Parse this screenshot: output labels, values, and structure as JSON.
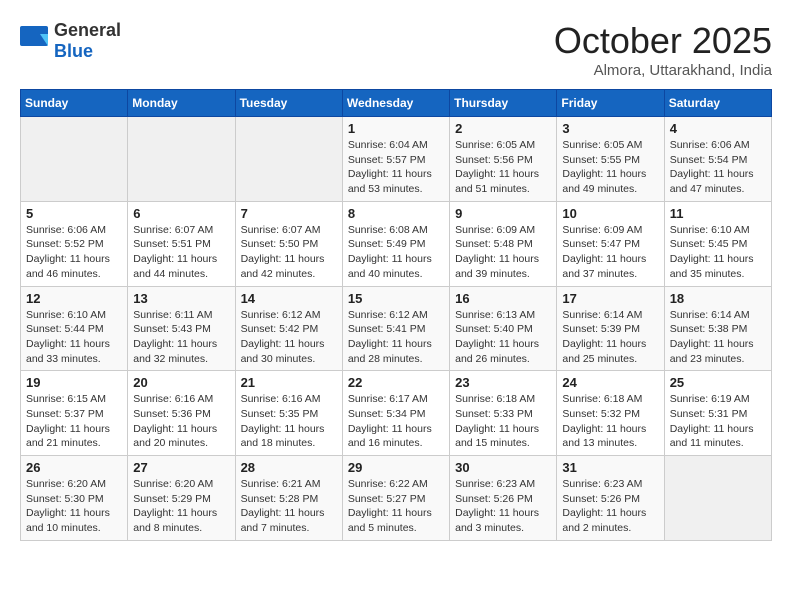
{
  "header": {
    "logo_general": "General",
    "logo_blue": "Blue",
    "month_title": "October 2025",
    "subtitle": "Almora, Uttarakhand, India"
  },
  "days_of_week": [
    "Sunday",
    "Monday",
    "Tuesday",
    "Wednesday",
    "Thursday",
    "Friday",
    "Saturday"
  ],
  "weeks": [
    [
      {
        "day": "",
        "info": ""
      },
      {
        "day": "",
        "info": ""
      },
      {
        "day": "",
        "info": ""
      },
      {
        "day": "1",
        "info": "Sunrise: 6:04 AM\nSunset: 5:57 PM\nDaylight: 11 hours and 53 minutes."
      },
      {
        "day": "2",
        "info": "Sunrise: 6:05 AM\nSunset: 5:56 PM\nDaylight: 11 hours and 51 minutes."
      },
      {
        "day": "3",
        "info": "Sunrise: 6:05 AM\nSunset: 5:55 PM\nDaylight: 11 hours and 49 minutes."
      },
      {
        "day": "4",
        "info": "Sunrise: 6:06 AM\nSunset: 5:54 PM\nDaylight: 11 hours and 47 minutes."
      }
    ],
    [
      {
        "day": "5",
        "info": "Sunrise: 6:06 AM\nSunset: 5:52 PM\nDaylight: 11 hours and 46 minutes."
      },
      {
        "day": "6",
        "info": "Sunrise: 6:07 AM\nSunset: 5:51 PM\nDaylight: 11 hours and 44 minutes."
      },
      {
        "day": "7",
        "info": "Sunrise: 6:07 AM\nSunset: 5:50 PM\nDaylight: 11 hours and 42 minutes."
      },
      {
        "day": "8",
        "info": "Sunrise: 6:08 AM\nSunset: 5:49 PM\nDaylight: 11 hours and 40 minutes."
      },
      {
        "day": "9",
        "info": "Sunrise: 6:09 AM\nSunset: 5:48 PM\nDaylight: 11 hours and 39 minutes."
      },
      {
        "day": "10",
        "info": "Sunrise: 6:09 AM\nSunset: 5:47 PM\nDaylight: 11 hours and 37 minutes."
      },
      {
        "day": "11",
        "info": "Sunrise: 6:10 AM\nSunset: 5:45 PM\nDaylight: 11 hours and 35 minutes."
      }
    ],
    [
      {
        "day": "12",
        "info": "Sunrise: 6:10 AM\nSunset: 5:44 PM\nDaylight: 11 hours and 33 minutes."
      },
      {
        "day": "13",
        "info": "Sunrise: 6:11 AM\nSunset: 5:43 PM\nDaylight: 11 hours and 32 minutes."
      },
      {
        "day": "14",
        "info": "Sunrise: 6:12 AM\nSunset: 5:42 PM\nDaylight: 11 hours and 30 minutes."
      },
      {
        "day": "15",
        "info": "Sunrise: 6:12 AM\nSunset: 5:41 PM\nDaylight: 11 hours and 28 minutes."
      },
      {
        "day": "16",
        "info": "Sunrise: 6:13 AM\nSunset: 5:40 PM\nDaylight: 11 hours and 26 minutes."
      },
      {
        "day": "17",
        "info": "Sunrise: 6:14 AM\nSunset: 5:39 PM\nDaylight: 11 hours and 25 minutes."
      },
      {
        "day": "18",
        "info": "Sunrise: 6:14 AM\nSunset: 5:38 PM\nDaylight: 11 hours and 23 minutes."
      }
    ],
    [
      {
        "day": "19",
        "info": "Sunrise: 6:15 AM\nSunset: 5:37 PM\nDaylight: 11 hours and 21 minutes."
      },
      {
        "day": "20",
        "info": "Sunrise: 6:16 AM\nSunset: 5:36 PM\nDaylight: 11 hours and 20 minutes."
      },
      {
        "day": "21",
        "info": "Sunrise: 6:16 AM\nSunset: 5:35 PM\nDaylight: 11 hours and 18 minutes."
      },
      {
        "day": "22",
        "info": "Sunrise: 6:17 AM\nSunset: 5:34 PM\nDaylight: 11 hours and 16 minutes."
      },
      {
        "day": "23",
        "info": "Sunrise: 6:18 AM\nSunset: 5:33 PM\nDaylight: 11 hours and 15 minutes."
      },
      {
        "day": "24",
        "info": "Sunrise: 6:18 AM\nSunset: 5:32 PM\nDaylight: 11 hours and 13 minutes."
      },
      {
        "day": "25",
        "info": "Sunrise: 6:19 AM\nSunset: 5:31 PM\nDaylight: 11 hours and 11 minutes."
      }
    ],
    [
      {
        "day": "26",
        "info": "Sunrise: 6:20 AM\nSunset: 5:30 PM\nDaylight: 11 hours and 10 minutes."
      },
      {
        "day": "27",
        "info": "Sunrise: 6:20 AM\nSunset: 5:29 PM\nDaylight: 11 hours and 8 minutes."
      },
      {
        "day": "28",
        "info": "Sunrise: 6:21 AM\nSunset: 5:28 PM\nDaylight: 11 hours and 7 minutes."
      },
      {
        "day": "29",
        "info": "Sunrise: 6:22 AM\nSunset: 5:27 PM\nDaylight: 11 hours and 5 minutes."
      },
      {
        "day": "30",
        "info": "Sunrise: 6:23 AM\nSunset: 5:26 PM\nDaylight: 11 hours and 3 minutes."
      },
      {
        "day": "31",
        "info": "Sunrise: 6:23 AM\nSunset: 5:26 PM\nDaylight: 11 hours and 2 minutes."
      },
      {
        "day": "",
        "info": ""
      }
    ]
  ]
}
